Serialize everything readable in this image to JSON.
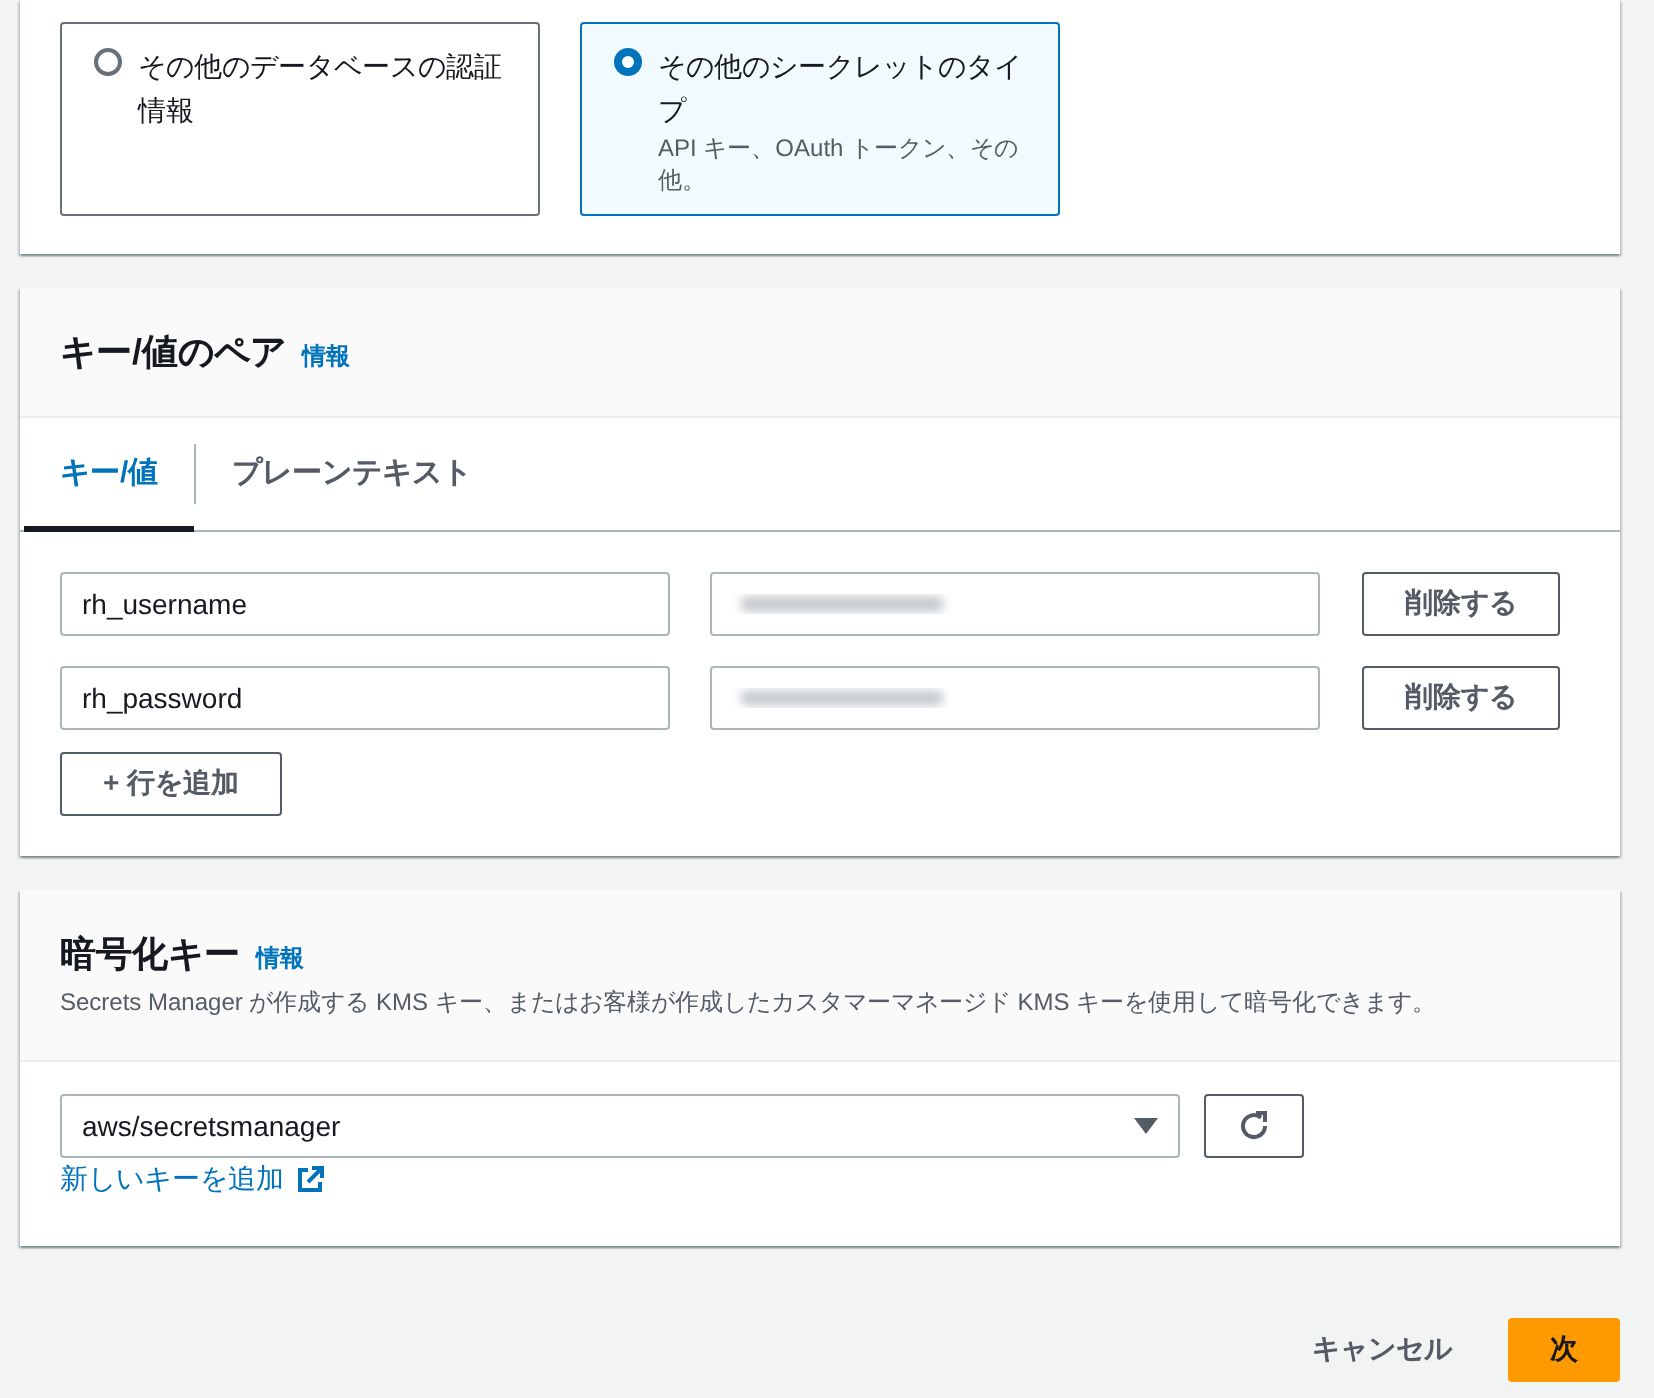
{
  "secret_type": {
    "options": [
      {
        "label": "その他のデータベースの認証情報",
        "selected": false
      },
      {
        "label": "その他のシークレットのタイプ",
        "description": "API キー、OAuth トークン、その他。",
        "selected": true
      }
    ]
  },
  "key_value": {
    "title": "キー/値のペア",
    "info_link": "情報",
    "tabs": [
      {
        "label": "キー/値",
        "selected": true
      },
      {
        "label": "プレーンテキスト",
        "selected": false
      }
    ],
    "rows": [
      {
        "key": "rh_username",
        "value_blurred": true,
        "delete_button": "削除する"
      },
      {
        "key": "rh_password",
        "value_blurred": true,
        "delete_button": "削除する"
      }
    ],
    "add_row_button": "+ 行を追加"
  },
  "encryption": {
    "title": "暗号化キー",
    "info_link": "情報",
    "description": "Secrets Manager が作成する KMS キー、またはお客様が作成したカスタマーマネージド KMS キーを使用して暗号化できます。",
    "select_value": "aws/secretsmanager",
    "add_key_link": "新しいキーを追加"
  },
  "footer": {
    "buttons": [
      {
        "label": "キャンセル",
        "kind": "link"
      },
      {
        "label": "次",
        "kind": "primary"
      }
    ]
  }
}
